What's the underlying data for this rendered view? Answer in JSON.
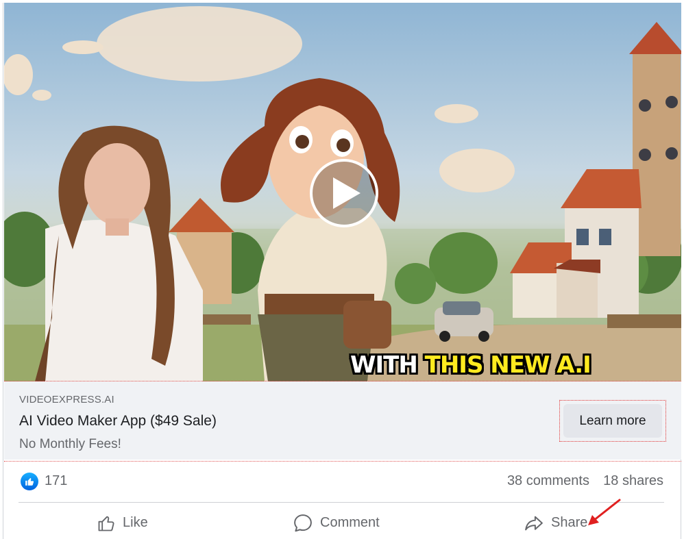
{
  "video": {
    "caption_part1": "WITH",
    "caption_part2": "THIS NEW A.I"
  },
  "ad": {
    "domain": "VIDEOEXPRESS.AI",
    "title": "AI Video Maker App ($49 Sale)",
    "subtitle": "No Monthly Fees!",
    "cta_label": "Learn more"
  },
  "stats": {
    "reactions_count": "171",
    "comments": "38 comments",
    "shares": "18 shares"
  },
  "actions": {
    "like_label": "Like",
    "comment_label": "Comment",
    "share_label": "Share"
  },
  "icons": {
    "play": "play-icon",
    "like_badge": "thumbs-up-icon",
    "like": "thumbs-up-outline-icon",
    "comment": "speech-bubble-icon",
    "share": "share-arrow-icon",
    "annotation": "red-arrow-annotation"
  },
  "colors": {
    "facebook_blue": "#0866ff",
    "caption_yellow": "#ffea1f",
    "annotation_red": "#e02020",
    "panel_gray": "#f0f2f5"
  }
}
